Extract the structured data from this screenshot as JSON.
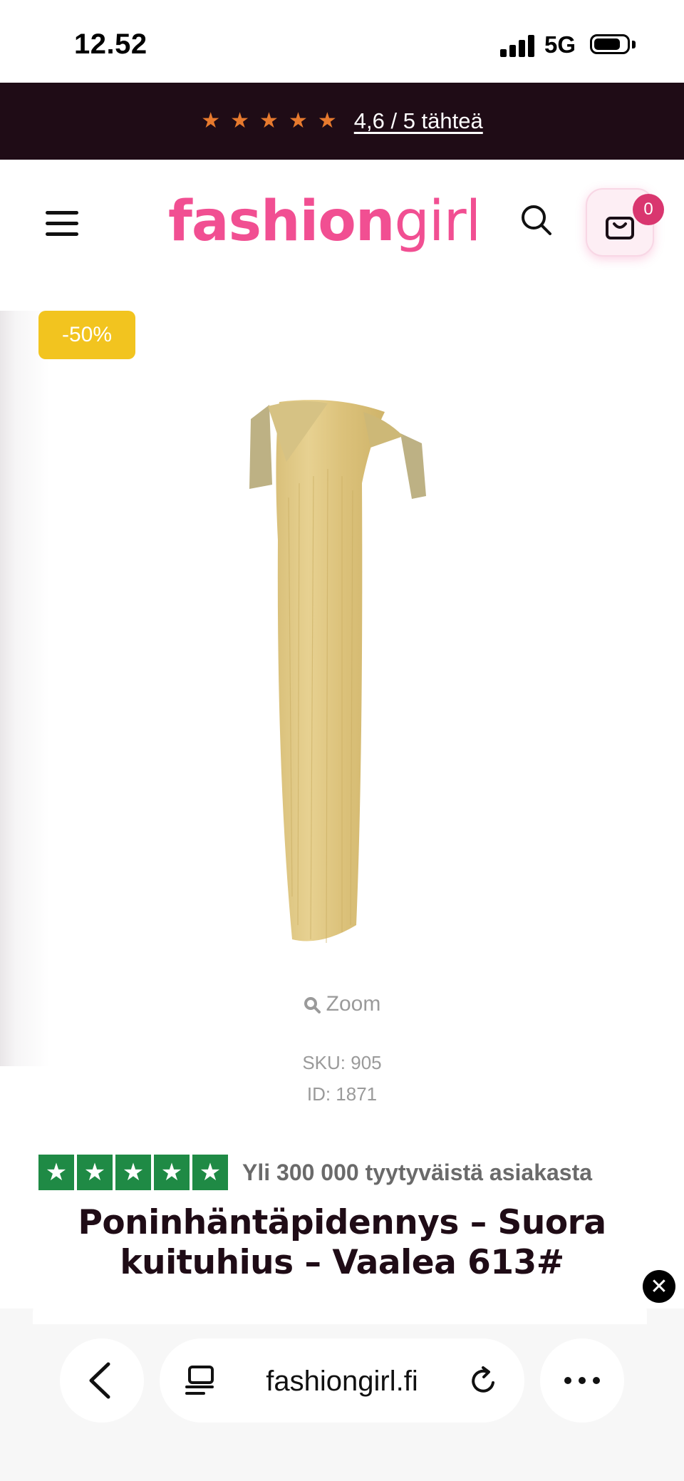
{
  "status_bar": {
    "time": "12.52",
    "network": "5G"
  },
  "rating_banner": {
    "stars": [
      "★",
      "★",
      "★",
      "★",
      "★"
    ],
    "text": "4,6 / 5 tähteä",
    "star_color": "#e77a2e"
  },
  "header": {
    "logo_bold": "fashion",
    "logo_light": "girl",
    "cart_count": "0",
    "brand_color": "#f14f92"
  },
  "product": {
    "discount": "-50%",
    "zoom_label": "Zoom",
    "sku": "SKU: 905",
    "id": "ID: 1871",
    "title": "Poninhäntäpidennys – Suora kuituhius – Vaalea 613#",
    "discount_color": "#f2c41f"
  },
  "trust": {
    "stars": [
      "★",
      "★",
      "★",
      "★",
      "★"
    ],
    "text": "Yli 300 000 tyytyväistä asiakasta",
    "color": "#1f8a45"
  },
  "popup": {
    "close_symbol": "✕"
  },
  "browser": {
    "url": "fashiongirl.fi"
  }
}
